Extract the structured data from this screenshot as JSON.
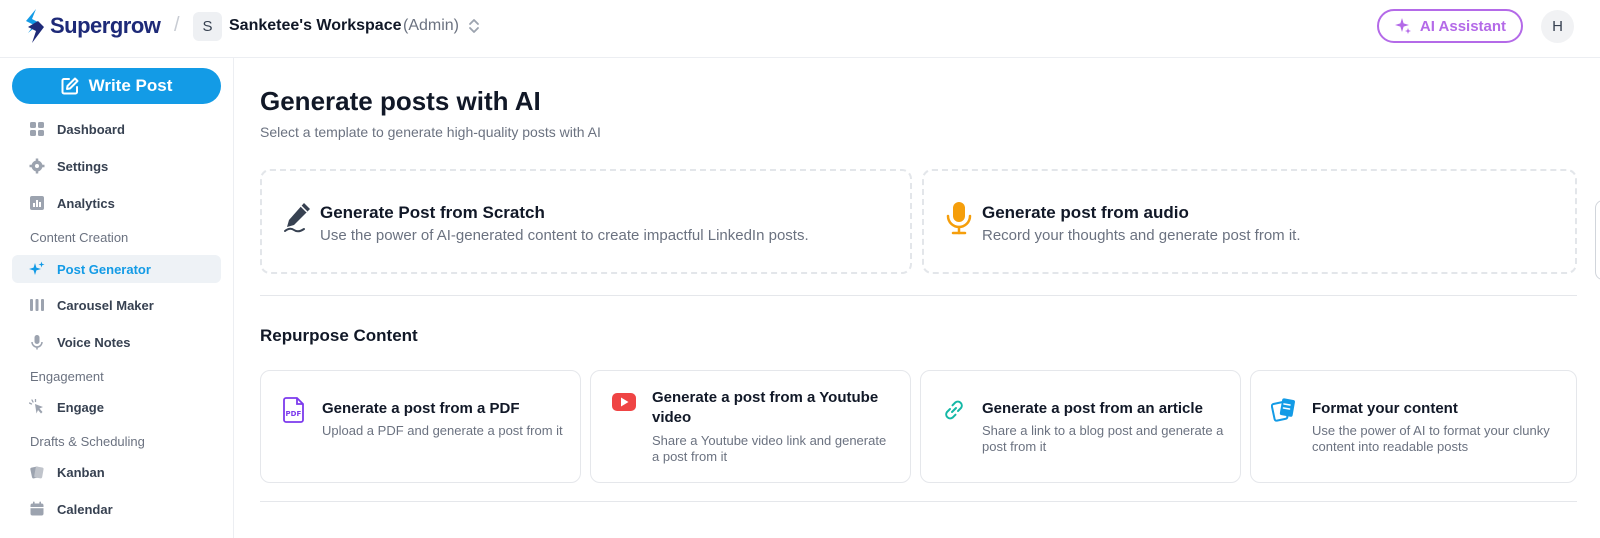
{
  "header": {
    "brand": "Supergrow",
    "separator": "/",
    "workspace_initial": "S",
    "workspace_name": "Sanketee's Workspace",
    "workspace_role": "(Admin)",
    "ai_assistant_label": "AI Assistant",
    "user_initial": "H"
  },
  "sidebar": {
    "write_post_label": "Write Post",
    "items": [
      {
        "label": "Dashboard"
      },
      {
        "label": "Settings"
      },
      {
        "label": "Analytics"
      },
      {
        "label": "Post Generator"
      },
      {
        "label": "Carousel Maker"
      },
      {
        "label": "Voice Notes"
      },
      {
        "label": "Engage"
      },
      {
        "label": "Kanban"
      },
      {
        "label": "Calendar"
      }
    ],
    "sections": {
      "content_creation": "Content Creation",
      "engagement": "Engagement",
      "drafts": "Drafts & Scheduling"
    }
  },
  "main": {
    "title": "Generate posts with AI",
    "subtitle": "Select a template to generate high-quality posts with AI",
    "templates": [
      {
        "title": "Generate Post from Scratch",
        "description": "Use the power of AI-generated content to create impactful LinkedIn posts."
      },
      {
        "title": "Generate post from audio",
        "description": "Record your thoughts and generate post from it."
      }
    ],
    "repurpose_title": "Repurpose Content",
    "repurpose": [
      {
        "title": "Generate a post from a PDF",
        "description": "Upload a PDF and generate a post from it"
      },
      {
        "title": "Generate a post from a Youtube video",
        "description": "Share a Youtube video link and generate a post from it"
      },
      {
        "title": "Generate a post from an article",
        "description": "Share a link to a blog post and generate a post from it"
      },
      {
        "title": "Format your content",
        "description": "Use the power of AI to format your clunky content into readable posts"
      }
    ]
  },
  "colors": {
    "accent": "#139be6",
    "brand_text": "#1e2a78",
    "ai_purple": "#b46ae8",
    "audio_orange": "#f59e0b",
    "youtube_red": "#ef4444",
    "link_teal": "#14b8a6",
    "pdf_violet": "#7c3aed"
  }
}
